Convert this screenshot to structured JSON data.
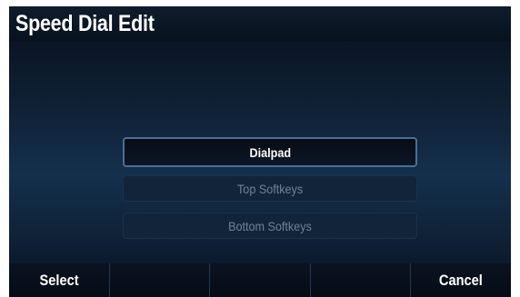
{
  "title": "Speed Dial Edit",
  "options": {
    "selected": "Dialpad",
    "item2": "Top Softkeys",
    "item3": "Bottom Softkeys"
  },
  "softkeys": {
    "key1": "Select",
    "key2": "",
    "key3": "",
    "key4": "",
    "key5": "Cancel"
  },
  "colors": {
    "background": "#040a14",
    "selected_border": "#4a6f93",
    "disabled_text": "#6f8496"
  }
}
